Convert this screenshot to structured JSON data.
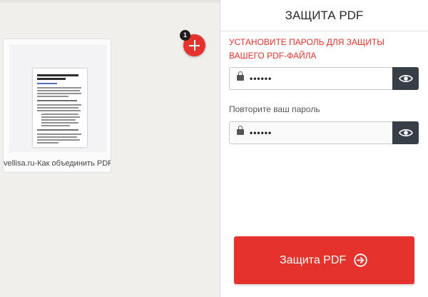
{
  "workspace": {
    "file_name": "vellisa.ru-Как объединить PDF...",
    "file_count": "1"
  },
  "panel": {
    "title": "ЗАЩИТА PDF",
    "instruction": "УСТАНОВИТЕ ПАРОЛЬ ДЛЯ ЗАЩИТЫ ВАШЕГО PDF-ФАЙЛА",
    "password_value": "••••••",
    "repeat_label": "Повторите ваш пароль",
    "repeat_value": "••••••",
    "submit_label": "Защита PDF"
  },
  "icons": {
    "add": "plus-icon",
    "lock": "lock-icon",
    "toggle": "eye-icon",
    "submit": "arrow-right-circle-icon"
  },
  "colors": {
    "accent": "#e5322d",
    "dark_button": "#383e48",
    "background": "#f0efeb"
  }
}
